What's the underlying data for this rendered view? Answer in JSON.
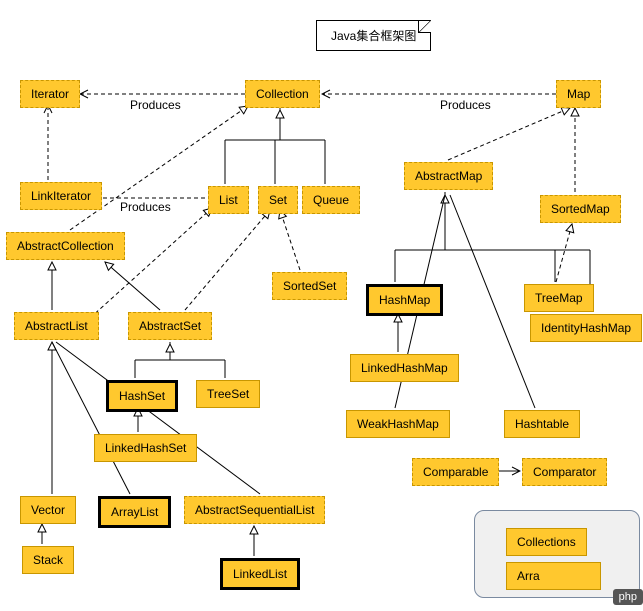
{
  "title": "Java集合框架图",
  "labels": {
    "produces1": "Produces",
    "produces2": "Produces",
    "produces3": "Produces"
  },
  "nodes": {
    "iterator": "Iterator",
    "collection": "Collection",
    "map": "Map",
    "linkIterator": "LinkIterator",
    "list": "List",
    "set": "Set",
    "queue": "Queue",
    "abstractMap": "AbstractMap",
    "sortedMap": "SortedMap",
    "abstractCollection": "AbstractCollection",
    "sortedSet": "SortedSet",
    "hashMap": "HashMap",
    "treeMap": "TreeMap",
    "abstractList": "AbstractList",
    "abstractSet": "AbstractSet",
    "identityHashMap": "IdentityHashMap",
    "linkedHashMap": "LinkedHashMap",
    "hashSet": "HashSet",
    "treeSet": "TreeSet",
    "weakHashMap": "WeakHashMap",
    "hashtable": "Hashtable",
    "linkedHashSet": "LinkedHashSet",
    "comparable": "Comparable",
    "comparator": "Comparator",
    "vector": "Vector",
    "arrayList": "ArrayList",
    "abstractSequentialList": "AbstractSequentialList",
    "stack": "Stack",
    "linkedList": "LinkedList",
    "collections": "Collections",
    "arrays": "Arra"
  },
  "watermark": "php"
}
